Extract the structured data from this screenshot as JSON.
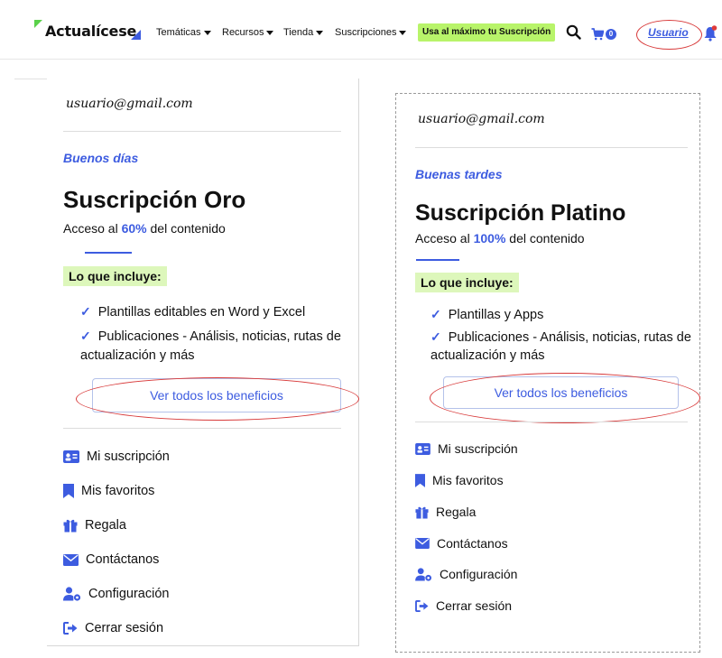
{
  "header": {
    "brand": "Actualícese",
    "nav": [
      "Temáticas",
      "Recursos",
      "Tienda",
      "Suscripciones"
    ],
    "promo": "Usa al máximo tu Suscripción",
    "cart_count": "0",
    "user_label": "Usuario"
  },
  "colors": {
    "accent": "#3d5ce0",
    "promo_bg": "#b8f46a",
    "highlight": "#ddf7bb",
    "annotation": "#d83a3a"
  },
  "panels": [
    {
      "email": "usuario@gmail.com",
      "greeting": "Buenos días",
      "plan": "Suscripción Oro",
      "access_prefix": "Acceso al ",
      "access_pct": "60%",
      "access_suffix": " del contenido",
      "includes_title": "Lo que incluye:",
      "features": [
        "Plantillas editables en Word y Excel",
        "Publicaciones - Análisis, noticias, rutas de",
        "actualización y más"
      ],
      "benefits_button": "Ver todos los beneficios",
      "menu": [
        "Mi suscripción",
        "Mis favoritos",
        "Regala",
        "Contáctanos",
        "Configuración",
        "Cerrar sesión"
      ]
    },
    {
      "email": "usuario@gmail.com",
      "greeting": "Buenas tardes",
      "plan": "Suscripción Platino",
      "access_prefix": "Acceso al ",
      "access_pct": "100%",
      "access_suffix": " del contenido",
      "includes_title": "Lo que incluye:",
      "features": [
        "Plantillas y Apps",
        "Publicaciones - Análisis, noticias, rutas de",
        "actualización y más"
      ],
      "benefits_button": "Ver todos los beneficios",
      "menu": [
        "Mi suscripción",
        "Mis favoritos",
        "Regala",
        "Contáctanos",
        "Configuración",
        "Cerrar sesión"
      ]
    }
  ],
  "icons": [
    "search-icon",
    "cart-icon",
    "bell-icon",
    "id-card-icon",
    "bookmark-icon",
    "gift-icon",
    "envelope-icon",
    "user-gear-icon",
    "sign-out-icon",
    "check-icon"
  ]
}
